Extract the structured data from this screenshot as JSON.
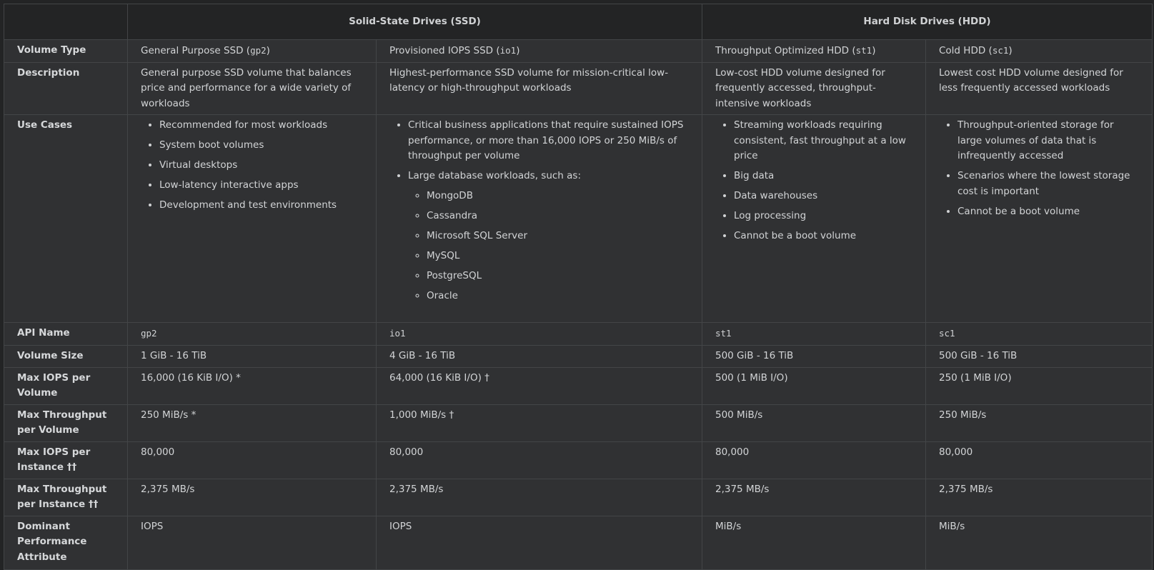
{
  "header": {
    "ssd_group": "Solid-State Drives (SSD)",
    "hdd_group": "Hard Disk Drives (HDD)"
  },
  "rows": {
    "volume_type": {
      "label": "Volume Type",
      "values": [
        {
          "text": "General Purpose SSD (",
          "code": "gp2",
          "suffix": ")"
        },
        {
          "text": "Provisioned IOPS SSD (",
          "code": "io1",
          "suffix": ")"
        },
        {
          "text": "Throughput Optimized HDD (",
          "code": "st1",
          "suffix": ")"
        },
        {
          "text": "Cold HDD (",
          "code": "sc1",
          "suffix": ")"
        }
      ]
    },
    "description": {
      "label": "Description",
      "values": [
        "General purpose SSD volume that balances price and performance for a wide variety of workloads",
        "Highest-performance SSD volume for mission-critical low-latency or high-throughput workloads",
        "Low-cost HDD volume designed for frequently accessed, throughput-intensive workloads",
        "Lowest cost HDD volume designed for less frequently accessed workloads"
      ]
    },
    "use_cases": {
      "label": "Use Cases",
      "gp2": [
        "Recommended for most workloads",
        "System boot volumes",
        "Virtual desktops",
        "Low-latency interactive apps",
        "Development and test environments"
      ],
      "io1": {
        "item1": "Critical business applications that require sustained IOPS performance, or more than 16,000 IOPS or 250 MiB/s of throughput per volume",
        "item2": "Large database workloads, such as:",
        "databases": [
          "MongoDB",
          "Cassandra",
          "Microsoft SQL Server",
          "MySQL",
          "PostgreSQL",
          "Oracle"
        ]
      },
      "st1": [
        "Streaming workloads requiring consistent, fast throughput at a low price",
        "Big data",
        "Data warehouses",
        "Log processing",
        "Cannot be a boot volume"
      ],
      "sc1": [
        "Throughput-oriented storage for large volumes of data that is infrequently accessed",
        "Scenarios where the lowest storage cost is important",
        "Cannot be a boot volume"
      ]
    },
    "api_name": {
      "label": "API Name",
      "values": [
        "gp2",
        "io1",
        "st1",
        "sc1"
      ]
    },
    "volume_size": {
      "label": "Volume Size",
      "values": [
        "1 GiB - 16 TiB",
        "4 GiB - 16 TiB",
        "500 GiB - 16 TiB",
        "500 GiB - 16 TiB"
      ]
    },
    "max_iops_volume": {
      "label": "Max IOPS per Volume",
      "values": [
        "16,000 (16 KiB I/O) *",
        "64,000 (16 KiB I/O) †",
        "500 (1 MiB I/O)",
        "250 (1 MiB I/O)"
      ]
    },
    "max_throughput_volume": {
      "label": "Max Throughput per Volume",
      "values": [
        "250 MiB/s *",
        "1,000 MiB/s †",
        "500 MiB/s",
        "250 MiB/s"
      ]
    },
    "max_iops_instance": {
      "label": "Max IOPS per Instance ††",
      "values": [
        "80,000",
        "80,000",
        "80,000",
        "80,000"
      ]
    },
    "max_throughput_instance": {
      "label": "Max Throughput per Instance ††",
      "values": [
        "2,375 MB/s",
        "2,375 MB/s",
        "2,375 MB/s",
        "2,375 MB/s"
      ]
    },
    "dominant_attribute": {
      "label": "Dominant Performance Attribute",
      "values": [
        "IOPS",
        "IOPS",
        "MiB/s",
        "MiB/s"
      ]
    }
  }
}
